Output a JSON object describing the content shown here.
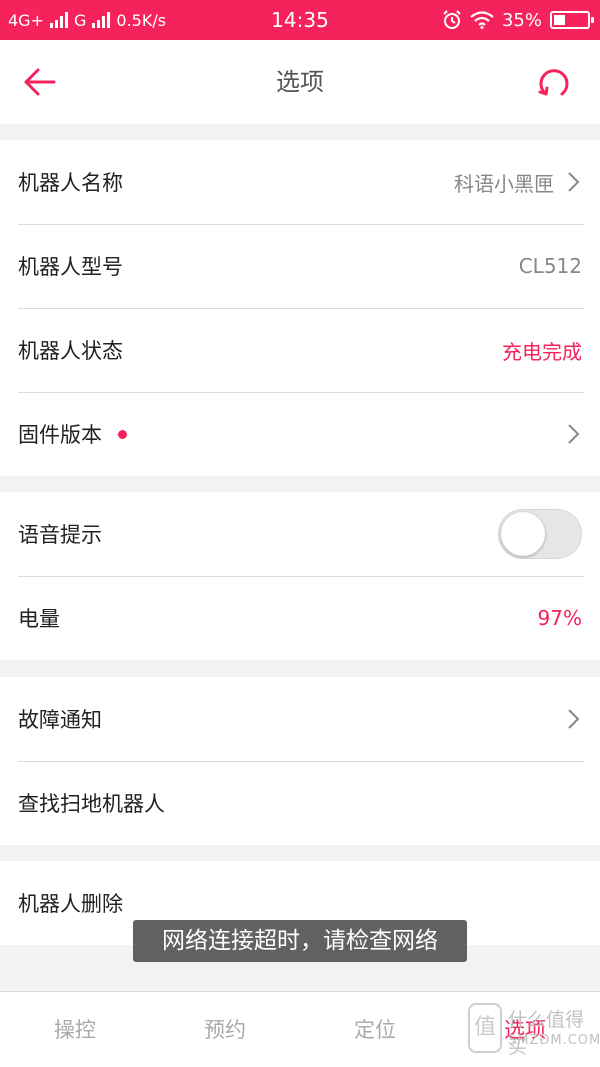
{
  "status_bar": {
    "network1": "4G+",
    "network2": "G",
    "speed": "0.5K/s",
    "time": "14:35",
    "battery_text": "35%",
    "battery_level": 0.35
  },
  "header": {
    "title": "选项",
    "back_icon": "arrow-left-icon",
    "refresh_icon": "refresh-icon"
  },
  "sections": {
    "info": {
      "robot_name_label": "机器人名称",
      "robot_name_value": "科语小黑匣",
      "robot_model_label": "机器人型号",
      "robot_model_value": "CL512",
      "robot_status_label": "机器人状态",
      "robot_status_value": "充电完成",
      "firmware_label": "固件版本"
    },
    "settings": {
      "voice_label": "语音提示",
      "voice_enabled": false,
      "battery_label": "电量",
      "battery_value": "97%"
    },
    "tools": {
      "fault_label": "故障通知",
      "find_label": "查找扫地机器人"
    },
    "danger": {
      "delete_label": "机器人删除"
    }
  },
  "toast": "网络连接超时，请检查网络",
  "tabs": [
    {
      "label": "操控",
      "active": false
    },
    {
      "label": "预约",
      "active": false
    },
    {
      "label": "定位",
      "active": false
    },
    {
      "label": "选项",
      "active": true
    }
  ],
  "watermark": {
    "badge": "值",
    "text": "什么值得买",
    "sub": "SMZDM.COM"
  },
  "colors": {
    "accent": "#f5225c",
    "background": "#f3f3f3"
  }
}
